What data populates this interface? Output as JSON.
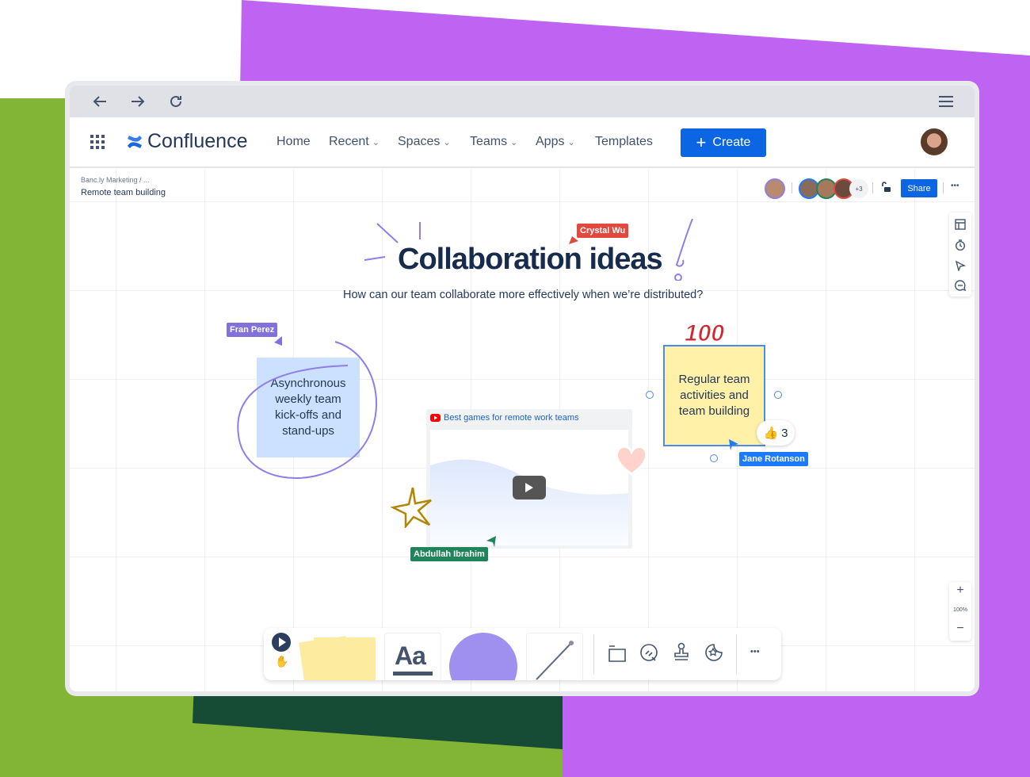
{
  "browser": {
    "back": "back-icon",
    "forward": "forward-icon",
    "reload": "reload-icon",
    "menu": "hamburger-icon"
  },
  "nav": {
    "logo": "Confluence",
    "items": [
      {
        "label": "Home"
      },
      {
        "label": "Recent",
        "dropdown": true
      },
      {
        "label": "Spaces",
        "dropdown": true
      },
      {
        "label": "Teams",
        "dropdown": true
      },
      {
        "label": "Apps",
        "dropdown": true
      },
      {
        "label": "Templates"
      }
    ],
    "create": "Create"
  },
  "page": {
    "breadcrumb": "Banc.ly Marketing / ...",
    "title": "Remote team building",
    "collaborators_more": "+3",
    "share": "Share",
    "more": "•••"
  },
  "board": {
    "title": "Collaboration ideas",
    "subtitle": "How can our team collaborate more effectively when we’re distributed?",
    "sticky_blue": "Asynchronous weekly team kick-offs and stand-ups",
    "sticky_yellow": "Regular team activities and team building",
    "sticker_100": "100",
    "video_title": "Best games for remote work teams",
    "reaction_count": "3",
    "cursors": {
      "crystal": "Crystal Wu",
      "fran": "Fran Perez",
      "jane": "Jane Rotanson",
      "abdullah": "Abdullah Ibrahim"
    }
  },
  "zoom": {
    "plus": "+",
    "level": "100%",
    "minus": "−"
  },
  "toolbar": {
    "text_tool": "Aa",
    "more": "•••"
  },
  "colors": {
    "brand": "#0c66e4",
    "purple": "#bf63f3",
    "green": "#82b536",
    "dark_green": "#164b35",
    "crystal": "#e2483d",
    "fran": "#8270db",
    "jane": "#1d7afc",
    "abdullah": "#1f845a",
    "sticky_yellow": "#fff1a8",
    "sticky_blue": "#cce0ff"
  }
}
